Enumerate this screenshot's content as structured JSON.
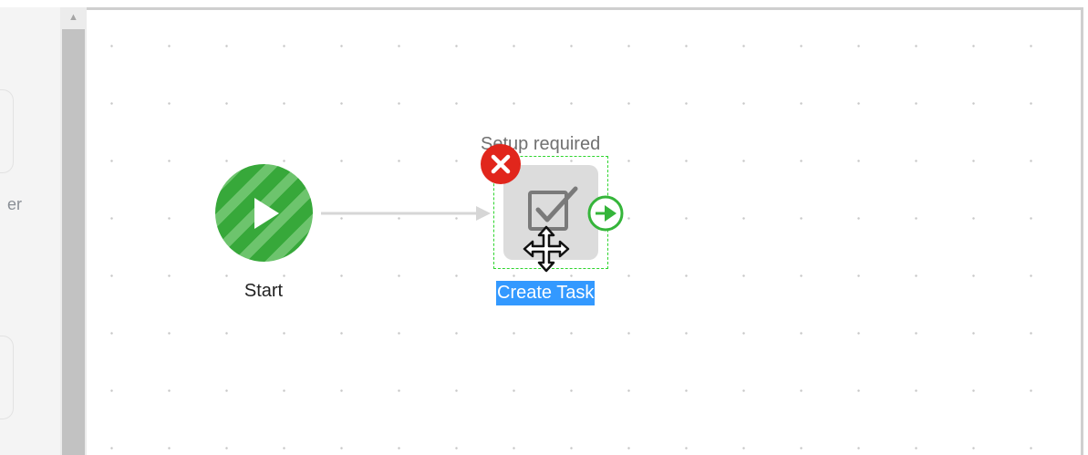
{
  "left_panel": {
    "visible_text": "er"
  },
  "canvas": {
    "start_node": {
      "label": "Start",
      "icon": "play-icon",
      "color": "#37a83a"
    },
    "task_node": {
      "label": "Create Task",
      "status_text": "Setup required",
      "icon": "task-checkbox-icon",
      "selected": true,
      "error_badge": "error-icon",
      "output_port": "output-port-icon"
    },
    "connector": "arrow-connector"
  },
  "cursor": "move-cursor",
  "colors": {
    "start_green": "#37a83a",
    "selection_dashed": "#2ed52e",
    "label_highlight": "#3399ff",
    "error_red": "#e1261c"
  }
}
